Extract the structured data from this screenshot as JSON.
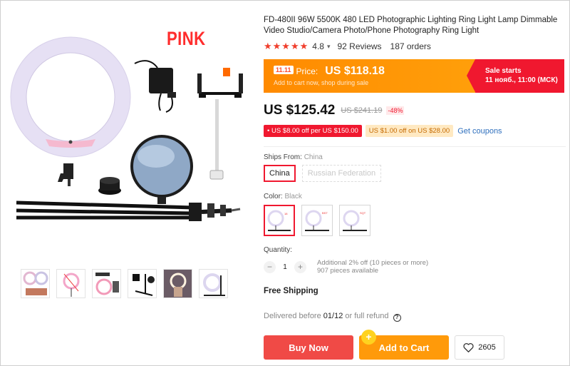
{
  "gallery": {
    "overlay_text": "PINK",
    "main_image_icon": "ring-light-kit-image",
    "thumbnail_count": 6
  },
  "product": {
    "title": "FD-480II 96W 5500K 480 LED Photographic Lighting Ring Light Lamp Dimmable Video Studio/Camera Photo/Phone Photography Ring Light",
    "rating": "4.8",
    "rating_caret": "▾",
    "reviews": "92 Reviews",
    "orders": "187 orders"
  },
  "promo": {
    "badge": "11.11",
    "price_label": "Price:",
    "price": "US $118.18",
    "subtitle": "Add to cart now, shop during sale",
    "sale_title": "Sale starts",
    "sale_time": "11 нояб., 11:00 (МСК)"
  },
  "pricing": {
    "price": "US $125.42",
    "old_price": "US $241.19",
    "discount": "-48%"
  },
  "coupons": {
    "coupon1": "• US $8.00 off per US $150.00",
    "coupon2": "US $1.00 off on US $28.00",
    "get_coupons": "Get coupons"
  },
  "shipping": {
    "label": "Ships From:",
    "value": "China",
    "options": [
      "China",
      "Russian Federation"
    ]
  },
  "color": {
    "label": "Color:",
    "value": "Black",
    "swatch_tags": [
      "18",
      "BST",
      "SQT"
    ]
  },
  "quantity": {
    "label": "Quantity:",
    "minus": "−",
    "plus": "+",
    "value": "1",
    "note1": "Additional 2% off (10 pieces or more)",
    "note2": "907 pieces available"
  },
  "delivery": {
    "free_shipping": "Free Shipping",
    "prefix": "Delivered before",
    "date": "01/12",
    "suffix": "or full refund",
    "help": "?"
  },
  "actions": {
    "buy_now": "Buy Now",
    "add_to_cart": "Add to Cart",
    "cart_plus": "+",
    "wishlist_count": "2605"
  },
  "colors": {
    "accent_red": "#f0182f",
    "promo_orange": "#ff9f0a",
    "link_blue": "#2e6fbd"
  }
}
